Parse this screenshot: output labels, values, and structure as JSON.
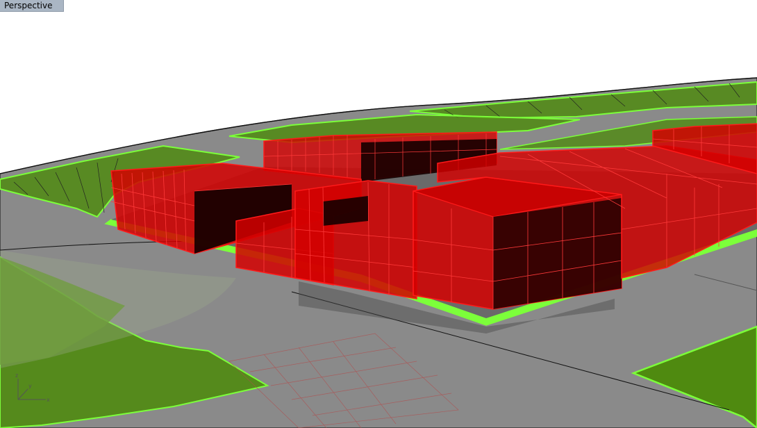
{
  "viewport": {
    "title": "Perspective"
  },
  "colors": {
    "background": "#ffffff",
    "ground": "#8a8a8a",
    "ground_dark": "#6f6f6f",
    "parcel_fill": "#4f8a10",
    "parcel_edge": "#7cff3a",
    "building_fill": "#d40000",
    "building_edge": "#ff1a1a",
    "building_dark": "#140000",
    "tab_background": "#aab6c4"
  },
  "scene": {
    "view": "perspective",
    "objects": [
      "terrain-surface",
      "parcels",
      "buildings",
      "plot-boundary",
      "road-lines"
    ]
  },
  "axes_widget": {
    "icon": "world-axes-icon"
  }
}
